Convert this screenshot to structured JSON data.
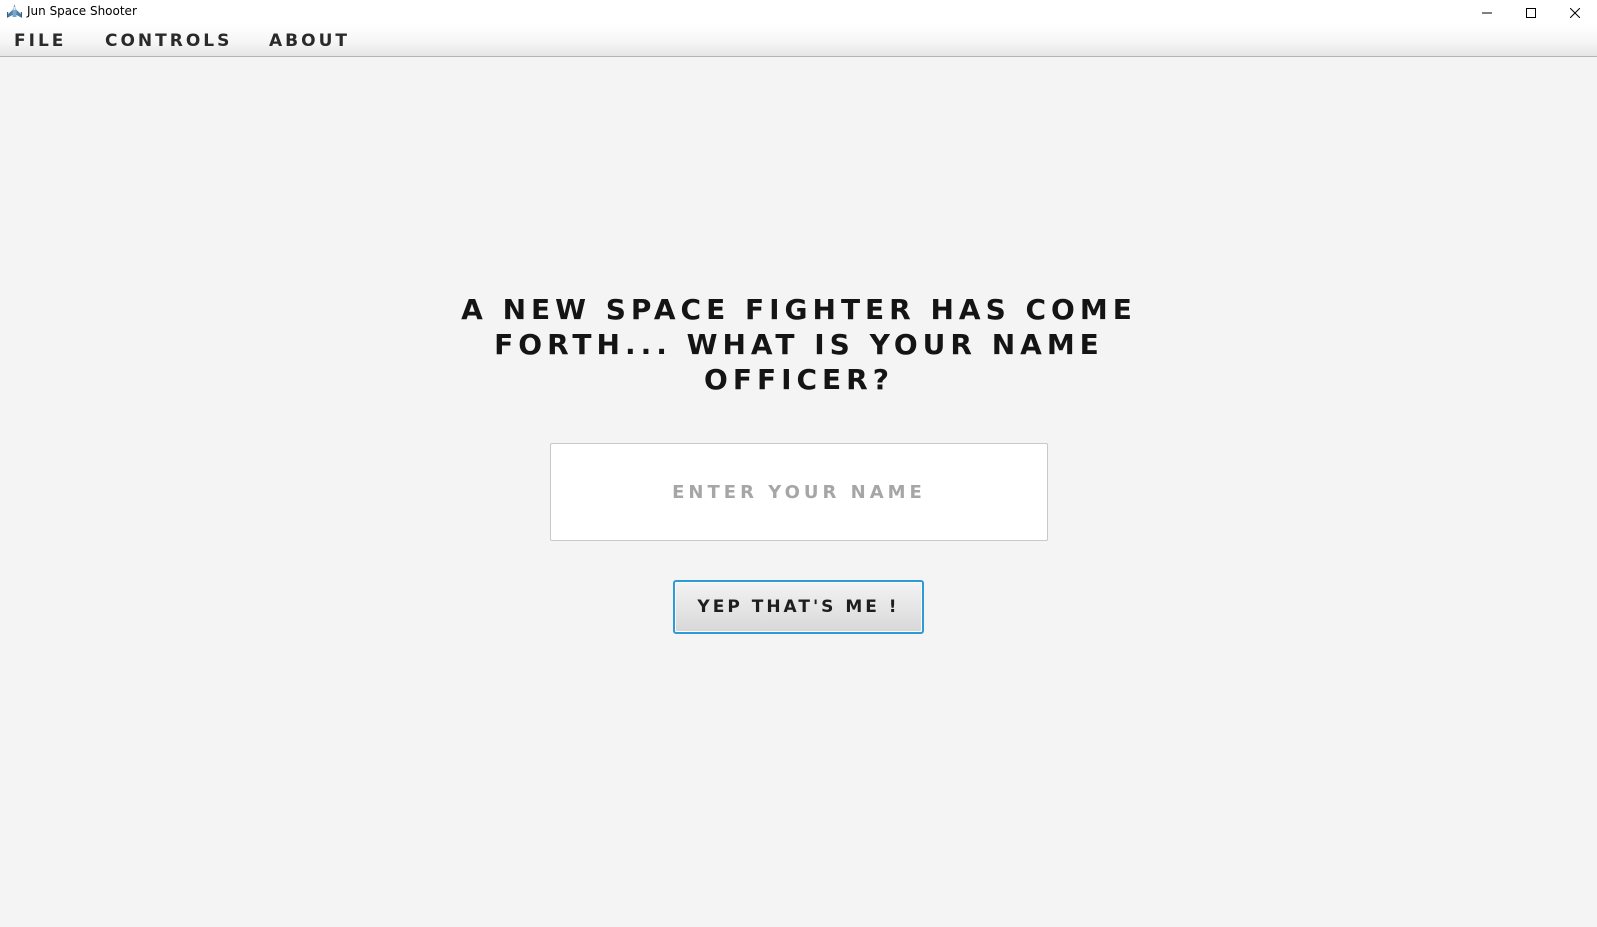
{
  "window": {
    "title": "Jun Space Shooter",
    "icons": {
      "app": "spaceship-icon",
      "minimize": "minimize-icon",
      "maximize": "maximize-icon",
      "close": "close-icon"
    }
  },
  "menubar": {
    "items": [
      {
        "label": "FILE"
      },
      {
        "label": "CONTROLS"
      },
      {
        "label": "ABOUT"
      }
    ]
  },
  "main": {
    "prompt": "A NEW SPACE FIGHTER HAS COME FORTH... WHAT IS YOUR NAME OFFICER?",
    "name_input": {
      "value": "",
      "placeholder": "ENTER YOUR NAME"
    },
    "confirm_button": "YEP THAT'S ME !"
  },
  "colors": {
    "background": "#f4f4f4",
    "focus_border": "#2f9bd6",
    "text": "#141414",
    "placeholder": "#a6a6a6"
  }
}
